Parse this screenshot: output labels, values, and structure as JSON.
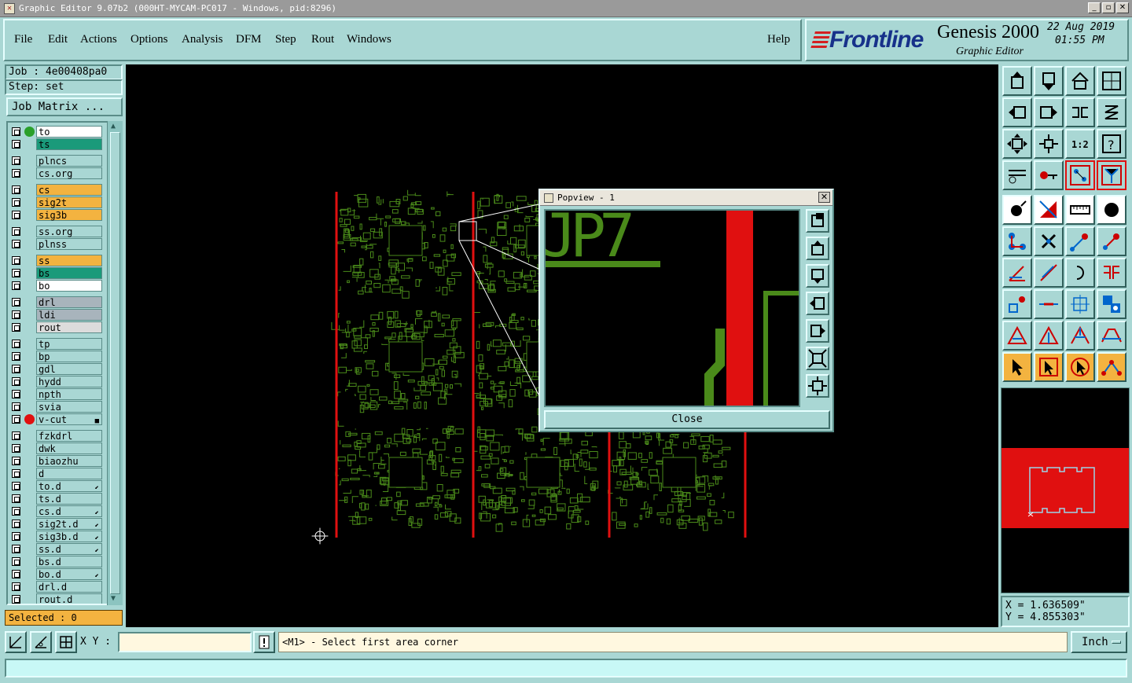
{
  "window": {
    "title": "Graphic Editor 9.07b2 (000HT-MYCAM-PC017 - Windows, pid:8296)"
  },
  "menu": {
    "file": "File",
    "edit": "Edit",
    "actions": "Actions",
    "options": "Options",
    "analysis": "Analysis",
    "dfm": "DFM",
    "step": "Step",
    "rout": "Rout",
    "windows": "Windows",
    "help": "Help"
  },
  "brand": {
    "logo": "Frontline",
    "product": "Genesis 2000",
    "subtitle": "Graphic Editor",
    "date": "22 Aug 2019",
    "time": "01:55 PM"
  },
  "job": {
    "job_label": "Job : 4e00408pa0",
    "step_label": "Step: set",
    "matrix_button": "Job Matrix ..."
  },
  "layers": [
    {
      "name": "to",
      "fill": "#ffffff",
      "dot": "#2aa02a"
    },
    {
      "name": "ts",
      "fill": "#1a9a7a"
    },
    {
      "name": "plncs",
      "fill": "#a9d7d4"
    },
    {
      "name": "cs.org",
      "fill": "#a9d7d4"
    },
    {
      "name": "cs",
      "fill": "#f3b340"
    },
    {
      "name": "sig2t",
      "fill": "#f3b340"
    },
    {
      "name": "sig3b",
      "fill": "#f3b340"
    },
    {
      "name": "ss.org",
      "fill": "#a9d7d4"
    },
    {
      "name": "plnss",
      "fill": "#a9d7d4"
    },
    {
      "name": "ss",
      "fill": "#f3b340"
    },
    {
      "name": "bs",
      "fill": "#1a9a7a"
    },
    {
      "name": "bo",
      "fill": "#ffffff"
    },
    {
      "name": "drl",
      "fill": "#a8b4bc"
    },
    {
      "name": "ldi",
      "fill": "#a8b4bc"
    },
    {
      "name": "rout",
      "fill": "#dcdcdc"
    },
    {
      "name": "tp",
      "fill": "#a9d7d4"
    },
    {
      "name": "bp",
      "fill": "#a9d7d4"
    },
    {
      "name": "gdl",
      "fill": "#a9d7d4"
    },
    {
      "name": "hydd",
      "fill": "#a9d7d4"
    },
    {
      "name": "npth",
      "fill": "#a9d7d4"
    },
    {
      "name": "svia",
      "fill": "#a9d7d4"
    },
    {
      "name": "v-cut",
      "fill": "#a9d7d4",
      "dot": "#e01010",
      "mark": "■"
    },
    {
      "name": "fzkdrl",
      "fill": "#a9d7d4"
    },
    {
      "name": "dwk",
      "fill": "#a9d7d4"
    },
    {
      "name": "biaozhu",
      "fill": "#a9d7d4"
    },
    {
      "name": "d",
      "fill": "#a9d7d4"
    },
    {
      "name": "to.d",
      "fill": "#a9d7d4",
      "mark": "⬋"
    },
    {
      "name": "ts.d",
      "fill": "#a9d7d4"
    },
    {
      "name": "cs.d",
      "fill": "#a9d7d4",
      "mark": "⬋"
    },
    {
      "name": "sig2t.d",
      "fill": "#a9d7d4",
      "mark": "⬋"
    },
    {
      "name": "sig3b.d",
      "fill": "#a9d7d4",
      "mark": "⬋"
    },
    {
      "name": "ss.d",
      "fill": "#a9d7d4",
      "mark": "⬋"
    },
    {
      "name": "bs.d",
      "fill": "#a9d7d4"
    },
    {
      "name": "bo.d",
      "fill": "#a9d7d4",
      "mark": "⬋"
    },
    {
      "name": "drl.d",
      "fill": "#a9d7d4"
    },
    {
      "name": "rout.d",
      "fill": "#a9d7d4"
    }
  ],
  "selected": "Selected : 0",
  "popview": {
    "title": "Popview - 1",
    "close_label": "Close",
    "zoom_text": "JP7"
  },
  "coords": {
    "x": "X = 1.636509\"",
    "y": "Y = 4.855303\""
  },
  "bottom": {
    "xy_label": "X Y :",
    "xy_value": "",
    "prompt": "<M1> - Select first area corner",
    "units": "Inch"
  },
  "colors": {
    "panel": "#a9d7d4",
    "copper": "#4a8a1a",
    "vcut": "#e01010"
  }
}
